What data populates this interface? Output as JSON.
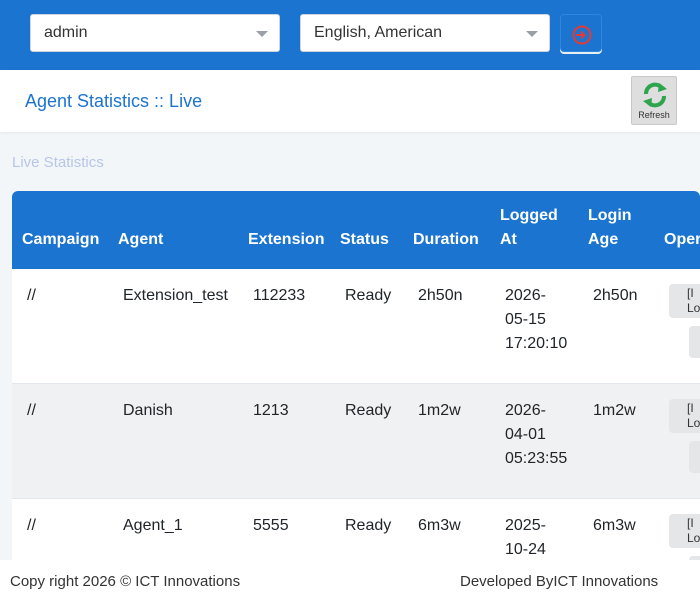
{
  "topbar": {
    "user_select": "admin",
    "language_select": "English, American",
    "logout_icon": "logout-icon",
    "accent": "#1b74d0"
  },
  "header": {
    "title": "Agent Statistics :: Live",
    "refresh_label": "Refresh"
  },
  "section_title": "Live Statistics",
  "table": {
    "columns": [
      "Campaign",
      "Agent",
      "Extension",
      "Status",
      "Duration",
      "Logged At",
      "Login Age",
      "Oper"
    ],
    "rows": [
      {
        "campaign": "//",
        "agent": "Extension_test",
        "extension": "112233",
        "status": "Ready",
        "duration": "2h50n",
        "logged_at": [
          "2026-",
          "05-15",
          "17:20:10"
        ],
        "login_age": "2h50n",
        "op1": "[I Lo"
      },
      {
        "campaign": "//",
        "agent": "Danish",
        "extension": "1213",
        "status": "Ready",
        "duration": "1m2w",
        "logged_at": [
          "2026-",
          "04-01",
          "05:23:55"
        ],
        "login_age": "1m2w",
        "op1": "[I Lo"
      },
      {
        "campaign": "//",
        "agent": "Agent_1",
        "extension": "5555",
        "status": "Ready",
        "duration": "6m3w",
        "logged_at": [
          "2025-",
          "10-24",
          ""
        ],
        "login_age": "6m3w",
        "op1": "[I Lo"
      }
    ]
  },
  "footer": {
    "copyright": "Copy right 2026 © ICT Innovations",
    "developer": "Developed ByICT Innovations"
  }
}
